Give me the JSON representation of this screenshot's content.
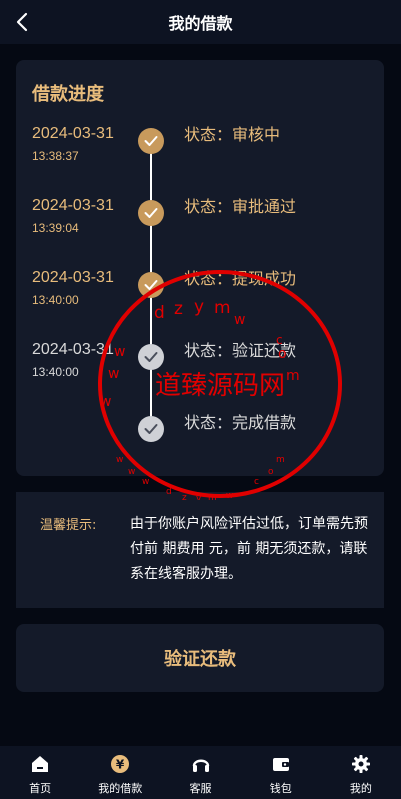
{
  "header": {
    "title": "我的借款",
    "back_icon": "chevron-left-icon"
  },
  "progress": {
    "title": "借款进度",
    "steps": [
      {
        "date": "2024-03-31",
        "time": "13:38:37",
        "status": "状态：审核中",
        "done": true
      },
      {
        "date": "2024-03-31",
        "time": "13:39:04",
        "status": "状态：审批通过",
        "done": true
      },
      {
        "date": "2024-03-31",
        "time": "13:40:00",
        "status": "状态：提现成功",
        "done": true
      },
      {
        "date": "2024-03-31",
        "time": "13:40:00",
        "status": "状态：验证还款",
        "done": false
      },
      {
        "date": "",
        "time": "",
        "status": "状态：完成借款",
        "done": false
      }
    ]
  },
  "tip": {
    "label": "温馨提示:",
    "text": "由于你账户风险评估过低，订单需先预付前 期费用 元，前 期无须还款，请联系在线客服办理。"
  },
  "action": {
    "verify_label": "验证还款"
  },
  "watermark": {
    "main": "道臻源码网",
    "letters": "dzymw.com"
  },
  "tabbar": {
    "items": [
      {
        "label": "首页",
        "icon": "home-icon"
      },
      {
        "label": "我的借款",
        "icon": "yen-coin-icon",
        "active": true
      },
      {
        "label": "客服",
        "icon": "headset-icon"
      },
      {
        "label": "钱包",
        "icon": "wallet-icon"
      },
      {
        "label": "我的",
        "icon": "gear-icon"
      }
    ]
  },
  "colors": {
    "accent": "#e8bc7c",
    "check_done": "#c89a5c",
    "card": "#141a29",
    "background": "#050913",
    "watermark": "#e00000"
  }
}
